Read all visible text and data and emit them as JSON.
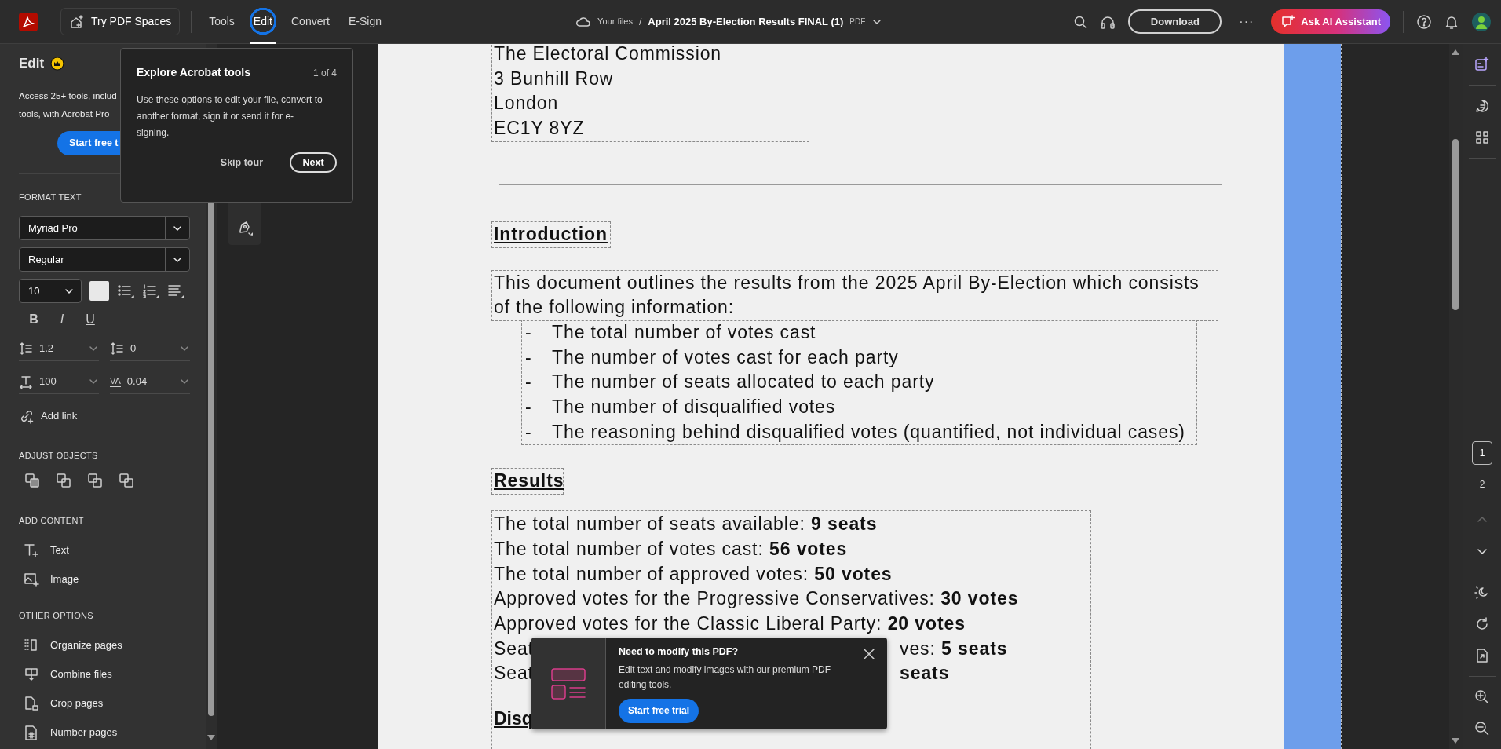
{
  "app_bar": {
    "spaces_button": "Try PDF Spaces",
    "tabs": [
      {
        "label": "Tools",
        "selected": false
      },
      {
        "label": "Edit",
        "selected": true
      },
      {
        "label": "Convert",
        "selected": false
      },
      {
        "label": "E-Sign",
        "selected": false
      }
    ],
    "breadcrumb": "Your files",
    "separator": "/",
    "file_name": "April 2025 By-Election Results FINAL (1)",
    "file_type": "PDF",
    "download_button": "Download",
    "more_button": "···",
    "ai_button": "Ask AI Assistant"
  },
  "edit_panel": {
    "title": "Edit",
    "description_lines": [
      "Access 25+ tools, includ",
      "tools, with Acrobat Pro"
    ],
    "trial_button": "Start free t",
    "format_text": {
      "heading": "FORMAT TEXT",
      "font": "Myriad Pro",
      "style": "Regular",
      "size": "10",
      "styles": [
        "B",
        "I",
        "U"
      ],
      "spacing": [
        {
          "kind": "line",
          "value": "1.2"
        },
        {
          "kind": "paragraph",
          "value": "0"
        },
        {
          "kind": "scale",
          "value": "100"
        },
        {
          "kind": "tracking",
          "icon_text": "VA",
          "value": "0.04"
        }
      ],
      "add_link": "Add link"
    },
    "adjust_objects": {
      "heading": "ADJUST OBJECTS"
    },
    "add_content": {
      "heading": "ADD CONTENT",
      "items": [
        {
          "kind": "text",
          "label": "Text"
        },
        {
          "kind": "image",
          "label": "Image"
        }
      ]
    },
    "other_options": {
      "heading": "OTHER OPTIONS",
      "items": [
        {
          "kind": "organize",
          "label": "Organize pages"
        },
        {
          "kind": "combine",
          "label": "Combine files"
        },
        {
          "kind": "crop",
          "label": "Crop pages"
        },
        {
          "kind": "number",
          "label": "Number pages"
        }
      ]
    }
  },
  "tour": {
    "title": "Explore Acrobat tools",
    "step": "1 of 4",
    "body": "Use these options to edit your file, convert to another format, sign it or send it for e-signing.",
    "skip_button": "Skip tour",
    "next_button": "Next"
  },
  "document": {
    "address_lines": [
      "The Electoral Commission",
      "3 Bunhill Row",
      "London",
      "EC1Y 8YZ"
    ],
    "intro_heading": "Introduction",
    "intro_paragraph": "This document outlines the results from the 2025 April By-Election which consists of the following information:",
    "bullets": [
      {
        "mark": "-",
        "text": "The total number of votes cast"
      },
      {
        "mark": "-",
        "text": "The number of votes cast for each party"
      },
      {
        "mark": "-",
        "text": "The number of seats allocated to each party"
      },
      {
        "mark": "-",
        "text": "The number of disqualified votes"
      },
      {
        "mark": "-",
        "text": "The reasoning behind disqualified votes (quantified, not individual cases)"
      }
    ],
    "results_heading": "Results",
    "results_lines": [
      {
        "text": "The total number of seats available: **9 seats**"
      },
      {
        "text": "The total number of votes cast: **56 votes**"
      },
      {
        "text": "The total number of approved votes: **50 votes**"
      },
      {
        "text": "Approved votes for the Progressive Conservatives: **30 votes**"
      },
      {
        "text": "Approved votes for the Classic Liberal Party: **20 votes**"
      },
      {
        "text": "Seat",
        "after_overlay": "ves: **5 seats**"
      },
      {
        "text": "Seat",
        "after_overlay": "**seats**"
      }
    ],
    "next_heading": "Disq"
  },
  "notice": {
    "title": "Need to modify this PDF?",
    "body": "Edit text and modify images with our premium PDF editing tools.",
    "button": "Start free trial"
  },
  "page_nav": {
    "pages": [
      {
        "label": "1",
        "selected": true
      },
      {
        "label": "2",
        "selected": false
      }
    ],
    "previous_disabled": true,
    "next_disabled": false
  }
}
